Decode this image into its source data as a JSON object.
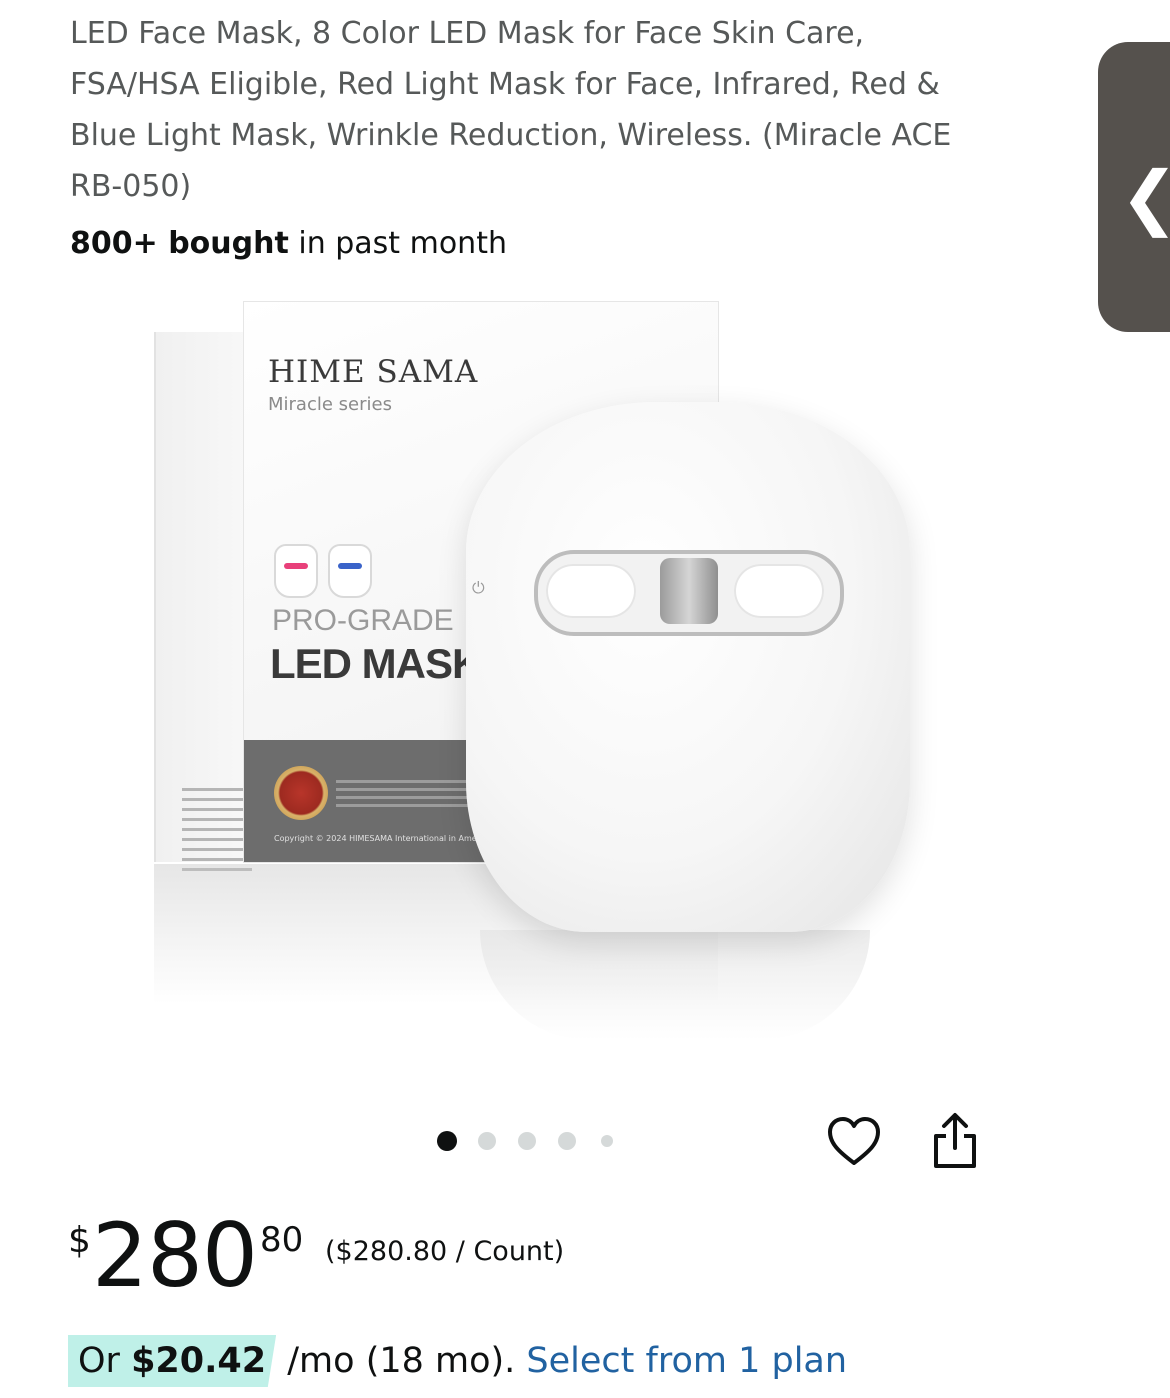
{
  "product": {
    "title": "LED Face Mask, 8 Color LED Mask for Face Skin Care, FSA/HSA Eligible, Red Light Mask for Face, Infrared, Red & Blue Light Mask, Wrinkle Reduction, Wireless. (Miracle ACE RB-050)",
    "bought_bold": "800+ bought",
    "bought_rest": " in past month"
  },
  "image": {
    "brand": "HIME SAMA",
    "series": "Miracle series",
    "pro_grade": "PRO-GRADE",
    "led_mask": "LED MASK",
    "copyright": "Copyright © 2024 HIMESAMA International in America. All rights re",
    "mini_mask_colors": [
      "#e8407a",
      "#3a63c9"
    ]
  },
  "carousel": {
    "total": 5,
    "active_index": 0
  },
  "actions": {
    "wishlist_icon": "heart-icon",
    "share_icon": "share-icon",
    "side_panel_icon": "chevron-left-icon"
  },
  "price": {
    "symbol": "$",
    "whole": "280",
    "fraction": "80",
    "unit_price": "($280.80 / Count)"
  },
  "installment": {
    "prefix": "Or ",
    "amount": "$20.42",
    "terms": " /mo (18 mo). ",
    "link": "Select from 1 plan"
  },
  "colors": {
    "link": "#2162a1",
    "highlight": "#bff0e8",
    "side_tab": "#55514d"
  }
}
